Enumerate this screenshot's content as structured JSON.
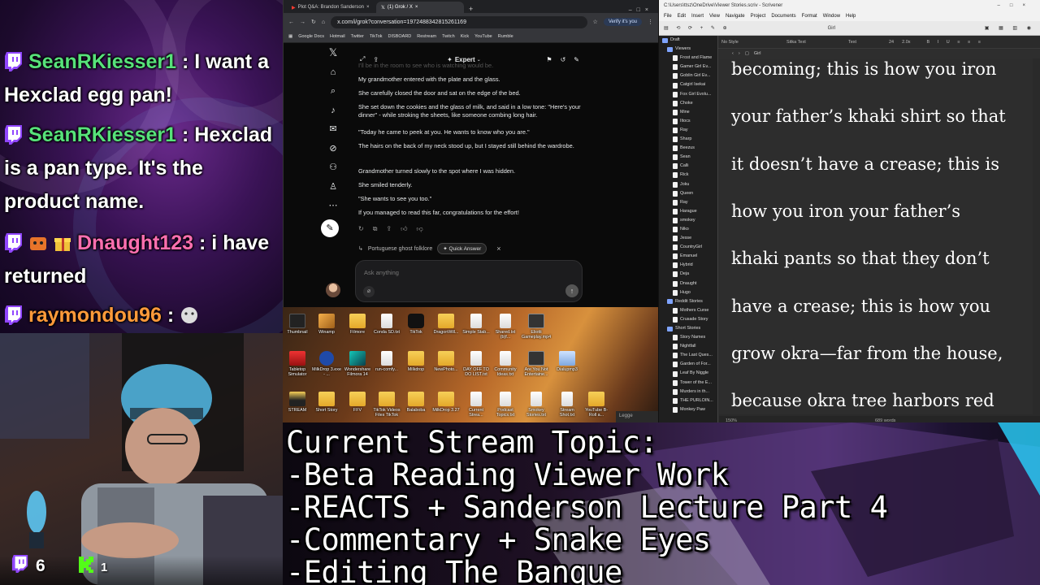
{
  "chat": {
    "messages": [
      {
        "user": "SeanRKiesser1",
        "text": " : I want a Hexclad egg pan!",
        "color": "#57e27a"
      },
      {
        "user": "SeanRKiesser1",
        "text": " : Hexclad is a pan type. It's the product name.",
        "color": "#57e27a"
      },
      {
        "user": "Dnaught123",
        "text": " : i have returned",
        "color": "#ff6fb0"
      },
      {
        "user": "raymondou96",
        "text": " : ",
        "color": "#ff9a3a"
      }
    ]
  },
  "stream_stats": {
    "twitch_viewers": "6",
    "kick_viewers": "1"
  },
  "browser": {
    "tabs": [
      "Plot Q&A: Brandon Sanderson",
      "(1) Grok / X"
    ],
    "url": "x.com/i/grok?conversation=1972488342815261169",
    "verify_label": "Verify it's you",
    "bookmarks": [
      "Google Docs",
      "Hotmail",
      "Twitter",
      "TikTok",
      "DISBOARD",
      "Restream",
      "Twitch",
      "Kick",
      "YouTube",
      "Rumble"
    ],
    "grok": {
      "mode_label": "Expert",
      "faded_line": "I'll be in the room to see who is watching would be.",
      "paragraphs": [
        "My grandmother entered with the plate and the glass.",
        "She carefully closed the door and sat on the edge of the bed.",
        "She set down the cookies and the glass of milk, and said in a low tone: \"Here's your dinner\" - while stroking the sheets, like someone combing long hair.",
        "\"Today he came to peek at you. He wants to know who you are.\"",
        "The hairs on the back of my neck stood up, but I stayed still behind the wardrobe.",
        "Grandmother turned slowly to the spot where I was hidden.",
        "She smiled tenderly.",
        "\"She wants to see you too.\"",
        "If you managed to read this far, congratulations for the effort!"
      ],
      "followup_text": "Portuguese ghost folklore",
      "quick_answer_label": "Quick Answer",
      "ask_placeholder": "Ask anything"
    }
  },
  "desktop": {
    "icons": [
      "Thumbnail",
      "Winamp",
      "Filmore",
      "Conda SD.txt",
      "TikTok",
      "DragonWill...",
      "Simple Stab...",
      "Shared.txt (b)f...",
      "Eliotti Gameplay.mp4",
      "Tabletop Simulator",
      "MilkDrop 3.exe - ...",
      "Wondershare Filmora 14",
      "run-comfy...",
      "Milkdrop",
      "NewPhoto...",
      "DAY OFF TO DO LIST.txt",
      "Community Ideas.txt",
      "Are You Not Entertaine...",
      "Dialupmp3",
      "STREAM",
      "Short Story",
      "FFV",
      "TikTok Videos Files TikTok",
      "Balaboba",
      "MilkDrop 3.27",
      "Current Strea...",
      "Podcast Topics.txt",
      "Smokey Stories.txt",
      "Stream Shot.txt",
      "YouTube B-Roll a..."
    ],
    "taskbar_label": "Legge"
  },
  "scrivener": {
    "title": "C:\\Users\\ttsz\\OneDrive\\Viewer Stories.scriv - Scrivener",
    "menu": [
      "File",
      "Edit",
      "Insert",
      "View",
      "Navigate",
      "Project",
      "Documents",
      "Format",
      "Window",
      "Help"
    ],
    "doc_title": "Girl",
    "format_bar": {
      "style": "No Style",
      "font": "Sitka Text",
      "weight": "Text",
      "size": "24",
      "spacing": "2.0x"
    },
    "binder": [
      {
        "label": "Draft",
        "type": "root"
      },
      {
        "label": "Viewers",
        "type": "folder"
      },
      {
        "label": "Frost and Flame",
        "type": "doc"
      },
      {
        "label": "Gamer Girl Ev...",
        "type": "doc"
      },
      {
        "label": "Goblin Girl Ev...",
        "type": "doc"
      },
      {
        "label": "Catgirl Isekai",
        "type": "doc"
      },
      {
        "label": "Fox Girl Evolu...",
        "type": "doc"
      },
      {
        "label": "Choke",
        "type": "doc"
      },
      {
        "label": "Mine",
        "type": "doc"
      },
      {
        "label": "Iltocs",
        "type": "doc"
      },
      {
        "label": "Ray",
        "type": "doc"
      },
      {
        "label": "Sharp",
        "type": "doc"
      },
      {
        "label": "Beezus",
        "type": "doc"
      },
      {
        "label": "Sean",
        "type": "doc"
      },
      {
        "label": "Calli",
        "type": "doc"
      },
      {
        "label": "Rick",
        "type": "doc"
      },
      {
        "label": "Joku",
        "type": "doc"
      },
      {
        "label": "Queen",
        "type": "doc"
      },
      {
        "label": "Ray",
        "type": "doc"
      },
      {
        "label": "Harague",
        "type": "doc"
      },
      {
        "label": "smokey",
        "type": "doc"
      },
      {
        "label": "Niko",
        "type": "doc"
      },
      {
        "label": "Jesse",
        "type": "doc"
      },
      {
        "label": "CountryGirl",
        "type": "doc"
      },
      {
        "label": "Emanuel",
        "type": "doc"
      },
      {
        "label": "Hybrid",
        "type": "doc"
      },
      {
        "label": "Deja",
        "type": "doc"
      },
      {
        "label": "Dnaught",
        "type": "doc"
      },
      {
        "label": "Hugo",
        "type": "doc"
      },
      {
        "label": "Reddit Stories",
        "type": "folder"
      },
      {
        "label": "Mothers Curse",
        "type": "doc"
      },
      {
        "label": "Crusade Story",
        "type": "doc"
      },
      {
        "label": "Short Stories",
        "type": "folder"
      },
      {
        "label": "Story Names",
        "type": "doc"
      },
      {
        "label": "Nightfall",
        "type": "doc"
      },
      {
        "label": "The Last Ques...",
        "type": "doc"
      },
      {
        "label": "Garden of For...",
        "type": "doc"
      },
      {
        "label": "Leaf By Niggle",
        "type": "doc"
      },
      {
        "label": "Tower of the E...",
        "type": "doc"
      },
      {
        "label": "Murders in th...",
        "type": "doc"
      },
      {
        "label": "THE PURLOIN...",
        "type": "doc"
      },
      {
        "label": "Monkey Paw",
        "type": "doc"
      }
    ],
    "editor_lines": [
      "becoming; this is how you iron",
      "your father’s khaki shirt so that",
      "it doesn’t have a crease; this is",
      "how you iron your father’s",
      "khaki pants so that they don’t",
      "have a crease; this is how you",
      "grow okra—far from the house,",
      "because okra tree harbors red"
    ],
    "zoom": "150%",
    "word_count": "689 words"
  },
  "topic": {
    "lines": [
      "Current Stream Topic:",
      "-Beta Reading Viewer Work",
      "-REACTS + Sanderson Lecture Part 4",
      "-Commentary + Snake Eyes",
      "-Editing The Banque"
    ]
  }
}
